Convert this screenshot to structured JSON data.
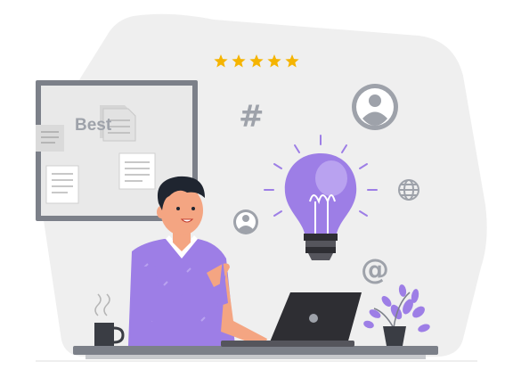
{
  "illustration": {
    "board_word": "Best",
    "hashtag_symbol": "#",
    "at_symbol": "@",
    "rating": {
      "stars_filled": 5,
      "stars_total": 5
    },
    "colors": {
      "accent": "#9d7ee6",
      "accent_light": "#b9a2f0",
      "star": "#f5b400",
      "background_blob": "#efefef",
      "board_fill": "#e8e8e8",
      "board_frame": "#7c8089",
      "icon_gray": "#9ea2aa",
      "dark": "#2e2e33",
      "skin": "#f4a582",
      "hair": "#1f2530"
    },
    "icons": [
      "star-icon",
      "user-avatar-icon",
      "hashtag-icon",
      "lightbulb-icon",
      "globe-icon",
      "at-sign-icon",
      "laptop-icon",
      "coffee-mug-icon",
      "plant-icon"
    ]
  }
}
